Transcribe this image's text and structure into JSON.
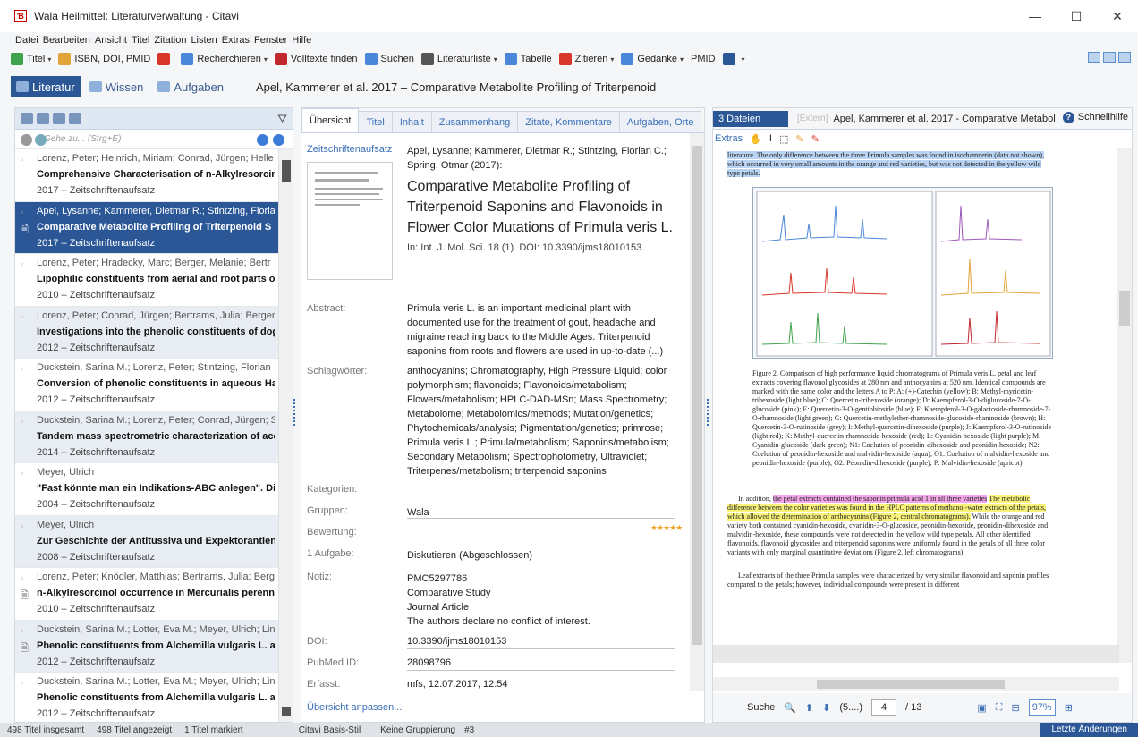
{
  "window": {
    "title": "Wala Heilmittel: Literaturverwaltung - Citavi",
    "min": "—",
    "max": "☐",
    "close": "✕"
  },
  "menu": [
    "Datei",
    "Bearbeiten",
    "Ansicht",
    "Titel",
    "Zitation",
    "Listen",
    "Extras",
    "Fenster",
    "Hilfe"
  ],
  "toolbar": [
    {
      "label": "Titel",
      "caret": true,
      "color": "#3fa34d"
    },
    {
      "label": "ISBN, DOI, PMID",
      "caret": false,
      "color": "#e2a33a"
    },
    {
      "label": "",
      "caret": false,
      "color": "#d9362b"
    },
    {
      "label": "Recherchieren",
      "caret": true,
      "color": "#4a87d8"
    },
    {
      "label": "Volltexte finden",
      "caret": false,
      "color": "#c0282d"
    },
    {
      "label": "Suchen",
      "caret": false,
      "color": "#4a87d8"
    },
    {
      "label": "Literaturliste",
      "caret": true,
      "color": "#555"
    },
    {
      "label": "Tabelle",
      "caret": false,
      "color": "#4a87d8"
    },
    {
      "label": "Zitieren",
      "caret": true,
      "color": "#d9362b"
    },
    {
      "label": "Gedanke",
      "caret": true,
      "color": "#4a87d8"
    },
    {
      "label": "PMID",
      "caret": false,
      "color": ""
    },
    {
      "label": "",
      "caret": true,
      "color": "#2b5797"
    }
  ],
  "nav": {
    "tabs": [
      "Literatur",
      "Wissen",
      "Aufgaben"
    ],
    "title": "Apel, Kammerer et al. 2017 – Comparative Metabolite Profiling of Triterpenoid"
  },
  "search": {
    "placeholder": "Gehe zu... (Strg+E)"
  },
  "list": [
    {
      "author": "Lorenz, Peter; Heinrich, Miriam; Conrad, Jürgen; Helle",
      "title": "Comprehensive Characterisation of n-Alkylresorcin",
      "year": "2017 – Zeitschriftenaufsatz",
      "style": "",
      "att": false
    },
    {
      "author": "Apel, Lysanne; Kammerer, Dietmar R.; Stintzing, Floria",
      "title": "Comparative Metabolite Profiling of Triterpenoid S",
      "year": "2017 – Zeitschriftenaufsatz",
      "style": "sel",
      "att": true
    },
    {
      "author": "Lorenz, Peter; Hradecky, Marc; Berger, Melanie; Bertr",
      "title": "Lipophilic constituents from aerial and root parts o",
      "year": "2010 – Zeitschriftenaufsatz",
      "style": "",
      "att": false
    },
    {
      "author": "Lorenz, Peter; Conrad, Jürgen; Bertrams, Julia; Berger,",
      "title": "Investigations into the phenolic constituents of dog",
      "year": "2012 – Zeitschriftenaufsatz",
      "style": "alt",
      "att": false
    },
    {
      "author": "Duckstein, Sarina M.; Lorenz, Peter; Stintzing, Florian",
      "title": "Conversion of phenolic constituents in aqueous Ha",
      "year": "2012 – Zeitschriftenaufsatz",
      "style": "",
      "att": false
    },
    {
      "author": "Duckstein, Sarina M.; Lorenz, Peter; Conrad, Jürgen; S",
      "title": "Tandem mass spectrometric characterization of ace",
      "year": "2014 – Zeitschriftenaufsatz",
      "style": "alt",
      "att": false
    },
    {
      "author": "Meyer, Ulrich",
      "title": "\"Fast könnte man ein Indikations-ABC anlegen\". Di",
      "year": "2004 – Zeitschriftenaufsatz",
      "style": "",
      "att": false
    },
    {
      "author": "Meyer, Ulrich",
      "title": "Zur Geschichte der Antitussiva und Expektorantien",
      "year": "2008 – Zeitschriftenaufsatz",
      "style": "alt",
      "att": false
    },
    {
      "author": "Lorenz, Peter; Knödler, Matthias; Bertrams, Julia; Berg",
      "title": "n-Alkylresorcinol occurrence in Mercurialis perennis",
      "year": "2010 – Zeitschriftenaufsatz",
      "style": "",
      "att": true
    },
    {
      "author": "Duckstein, Sarina M.; Lotter, Eva M.; Meyer, Ulrich; Lin",
      "title": "Phenolic constituents from Alchemilla vulgaris L. an",
      "year": "2012 – Zeitschriftenaufsatz",
      "style": "alt",
      "att": true
    },
    {
      "author": "Duckstein, Sarina M.; Lotter, Eva M.; Meyer, Ulrich; Lin",
      "title": "Phenolic constituents from Alchemilla vulgaris L. an",
      "year": "2012 – Zeitschriftenaufsatz",
      "style": "",
      "att": false
    }
  ],
  "tabs": [
    "Übersicht",
    "Titel",
    "Inhalt",
    "Zusammenhang",
    "Zitate, Kommentare",
    "Aufgaben, Orte"
  ],
  "detail": {
    "type": "Zeitschriftenaufsatz",
    "authors": "Apel, Lysanne; Kammerer, Dietmar R.; Stintzing, Florian C.; Spring, Otmar (2017):",
    "title": "Comparative Metabolite Profiling of Triterpenoid Saponins and Flavonoids in Flower Color Mutations of Primula veris L.",
    "source": "In: Int. J. Mol. Sci. 18 (1). DOI: 10.3390/ijms18010153.",
    "abstract_label": "Abstract:",
    "abstract": "Primula veris L. is an important medicinal plant with documented use for the treatment of gout, headache and migraine reaching back to the Middle Ages. Triterpenoid saponins from roots and flowers are used in up-to-date (...)",
    "keywords_label": "Schlagwörter:",
    "keywords": "anthocyanins; Chromatography, High Pressure Liquid; color polymorphism; flavonoids; Flavonoids/metabolism; Flowers/metabolism; HPLC-DAD-MSn; Mass Spectrometry; Metabolome; Metabolomics/methods; Mutation/genetics; Phytochemicals/analysis; Pigmentation/genetics; primrose; Primula veris L.; Primula/metabolism; Saponins/metabolism; Secondary Metabolism; Spectrophotometry, Ultraviolet; Triterpenes/metabolism; triterpenoid saponins",
    "categories_label": "Kategorien:",
    "groups_label": "Gruppen:",
    "groups": "Wala",
    "rating_label": "Bewertung:",
    "rating": "★★★★★",
    "task_label": "1 Aufgabe:",
    "task": "Diskutieren (Abgeschlossen)",
    "note_label": "Notiz:",
    "note": [
      "PMC5297786",
      "Comparative Study",
      "Journal Article",
      "The authors declare no conflict of interest."
    ],
    "doi_label": "DOI:",
    "doi": "10.3390/ijms18010153",
    "pubmed_label": "PubMed ID:",
    "pubmed": "28098796",
    "created_label": "Erfasst:",
    "created": "mfs, 12.07.2017, 12:54",
    "customize": "Übersicht anpassen..."
  },
  "viewer": {
    "files": "3 Dateien",
    "ext": "[Extern]",
    "title": "Apel, Kammerer et al. 2017 - Comparative Metabol",
    "help": "Schnellhilfe",
    "extras": "Extras",
    "text_top": "literature. The only difference between the three Primula samples was found in isorhamnetin (data not shown), which occurred in very small amounts in the orange and red varieties, but was not detected in the yellow wild type petals.",
    "caption": "Figure 2. Comparison of high performance liquid chromatograms of Primula veris L. petal and leaf extracts covering flavonol glycosides at 280 nm and anthocyanins at 520 nm. Identical compounds are marked with the same color and the letters A to P: A: (+)-Catechin (yellow); B: Methyl-myricetin-trihexoside (light blue); C: Quercetin-trihexoside (orange); D: Kaempferol-3-O-diglucoside-7-O-glucoside (pink); E: Quercetin-3-O-gentiobioside (blue); F: Kaempferol-3-O-galactoside-rhamnoside-7-O-rhamnoside (light green); G: Quercetin-methylether-rhamnoside-glucoside-rhamnoside (brown); H: Quercetin-3-O-rutinoside (grey); I: Methyl-quercetin-dihexoside (purple); J: Kaempferol-3-O-rutinoside (light red); K: Methyl-quercetin-rhamnoside-hexoside (red); L: Cyanidin-hexoside (light purple); M: Cyanidin-glucoside (dark green); N1: Coelution of peonidin-dihexoside and peonidin-hexoside; N2: Coelution of peonidin-hexoside and malvidin-hexoside (aqua); O1: Coelution of malvidin-hexoside and peonidin-hexoside (purple); O2: Peonidin-dihexoside (purple); P: Malvidin-hexoside (apricot).",
    "para1_a": "In addition, ",
    "para1_hl": "the petal extracts contained the saponin primula acid 1 in all three varieties",
    "para1_y": "The metabolic difference between the color varieties was found in the HPLC patterns of methanol-water extracts of the petals, which allowed the determination of anthocyanins (Figure 2, central chromatograms).",
    "para1_b": " While the orange and red variety both contained cyanidin-hexoside, cyanidin-3-O-glucoside, peonidin-hexoside, peonidin-dihexoside and malvidin-hexoside, these compounds were not detected in the yellow wild type petals. All other identified flavonoids, flavonoid glycosides and triterpenoid saponins were uniformly found in the petals of all three color variants with only marginal quantitative deviations (Figure 2, left chromatograms).",
    "para2": "Leaf extracts of the three Primula samples were characterized by very similar flavonoid and saponin profiles compared to the petals; however, individual compounds were present in different",
    "search": "Suche",
    "pagebox": "(5....)",
    "page": "4",
    "pages": "/ 13",
    "zoom": "97%"
  },
  "status": {
    "total": "498 Titel insgesamt",
    "shown": "498 Titel angezeigt",
    "marked": "1 Titel markiert",
    "style": "Citavi Basis-Stil",
    "group": "Keine Gruppierung",
    "num": "#3",
    "last": "Letzte Änderungen"
  }
}
